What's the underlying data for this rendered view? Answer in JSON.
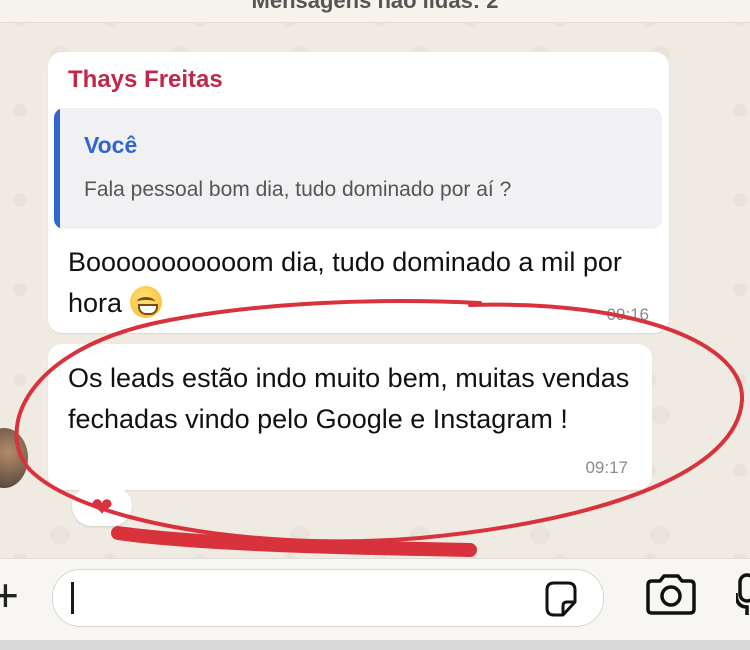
{
  "header": {
    "unread_banner": "Mensagens não lidas: 2"
  },
  "messages": [
    {
      "sender": "Thays Freitas",
      "quoted": {
        "author": "Você",
        "text": "Fala pessoal bom dia, tudo dominado por aí ?"
      },
      "text": "Booooooooooom dia, tudo dominado a mil por hora",
      "time": "09:16"
    },
    {
      "text": "Os leads estão indo muito bem, muitas vendas fechadas vindo pelo Google e Instagram !",
      "time": "09:17",
      "reaction": "❤"
    }
  ],
  "icons": {
    "attach": "plus-icon",
    "sticker": "sticker-icon",
    "camera": "camera-icon",
    "microphone": "microphone-icon"
  },
  "colors": {
    "sender_name": "#c0284a",
    "quote_accent": "#2f67d1",
    "annotation_stroke": "#d8323d",
    "chat_background": "#efeae2"
  }
}
